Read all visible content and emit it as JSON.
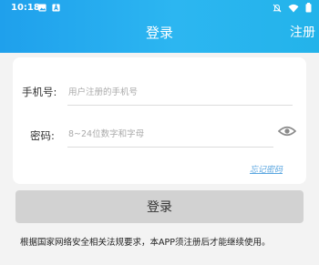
{
  "status_bar": {
    "time": "10:18",
    "icons_left": [
      "image-icon",
      "a-box-icon"
    ],
    "icons_right": [
      "no-notification-icon",
      "wifi-icon",
      "battery-icon"
    ]
  },
  "header": {
    "title": "登录",
    "register_label": "注册",
    "gradient_colors": [
      "#1fa0ec",
      "#2cb6f1",
      "#23b3ea"
    ]
  },
  "form": {
    "phone": {
      "label": "手机号:",
      "placeholder": "用户注册的手机号",
      "value": ""
    },
    "password": {
      "label": "密码:",
      "placeholder": "8~24位数字和字母",
      "value": "",
      "toggle_icon": "eye-icon"
    },
    "forgot_label": "忘记密码",
    "forgot_color": "#5aa6e0"
  },
  "login_button": {
    "label": "登录",
    "color": "#d2d2d2"
  },
  "notice": "根据国家网络安全相关法规要求，本APP须注册后才能继续使用。"
}
